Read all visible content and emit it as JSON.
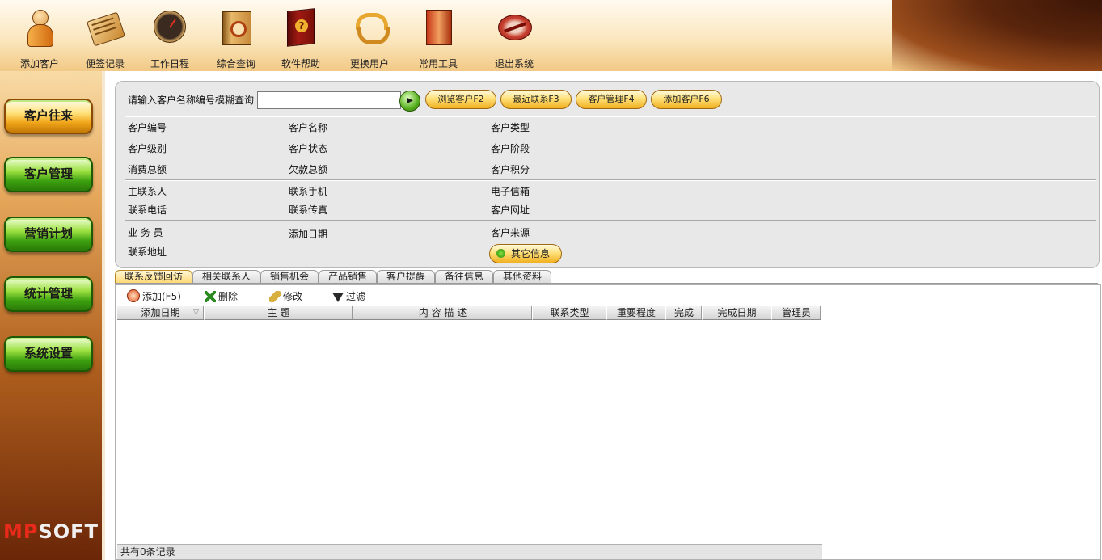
{
  "toolbar": {
    "items": [
      {
        "label": "添加客户",
        "icon": "add-customer-icon"
      },
      {
        "label": "便签记录",
        "icon": "notepad-icon"
      },
      {
        "label": "工作日程",
        "icon": "clock-icon"
      },
      {
        "label": "综合查询",
        "icon": "search-book-icon"
      },
      {
        "label": "软件帮助",
        "icon": "help-book-icon"
      },
      {
        "label": "更换用户",
        "icon": "switch-user-icon"
      },
      {
        "label": "常用工具",
        "icon": "tools-icon"
      },
      {
        "label": "退出系统",
        "icon": "exit-icon"
      }
    ]
  },
  "sidebar": {
    "items": [
      {
        "label": "客户往来",
        "active": true
      },
      {
        "label": "客户管理"
      },
      {
        "label": "营销计划"
      },
      {
        "label": "统计管理"
      },
      {
        "label": "系统设置"
      }
    ],
    "logo": {
      "part1": "MP",
      "part2": "SOFT"
    }
  },
  "search": {
    "prompt": "请输入客户名称编号模糊查询",
    "value": "",
    "go_icon": "play-icon",
    "buttons": [
      "浏览客户F2",
      "最近联系F3",
      "客户管理F4",
      "添加客户F6"
    ]
  },
  "fields": {
    "group1": [
      [
        "客户编号",
        "客户名称",
        "客户类型"
      ],
      [
        "客户级别",
        "客户状态",
        "客户阶段"
      ],
      [
        "消费总额",
        "欠款总额",
        "客户积分"
      ]
    ],
    "group2": [
      [
        "主联系人",
        "联系手机",
        "电子信箱"
      ],
      [
        "联系电话",
        "联系传真",
        "客户网址"
      ]
    ],
    "group3": {
      "salesman": "业 务 员",
      "add_date": "添加日期",
      "source": "客户来源",
      "address": "联系地址"
    },
    "other_button": "其它信息"
  },
  "tabs": [
    "联系反馈回访",
    "相关联系人",
    "销售机会",
    "产品销售",
    "客户提醒",
    "备往信息",
    "其他资料"
  ],
  "grid": {
    "tools": [
      {
        "label": "添加(F5)",
        "icon": "add-icon"
      },
      {
        "label": "删除",
        "icon": "delete-icon"
      },
      {
        "label": "修改",
        "icon": "edit-icon"
      },
      {
        "label": "过滤",
        "icon": "filter-icon"
      }
    ],
    "columns": [
      "添加日期",
      "主 题",
      "内 容 描 述",
      "联系类型",
      "重要程度",
      "完成",
      "完成日期",
      "管理员"
    ],
    "footer": "共有0条记录"
  }
}
